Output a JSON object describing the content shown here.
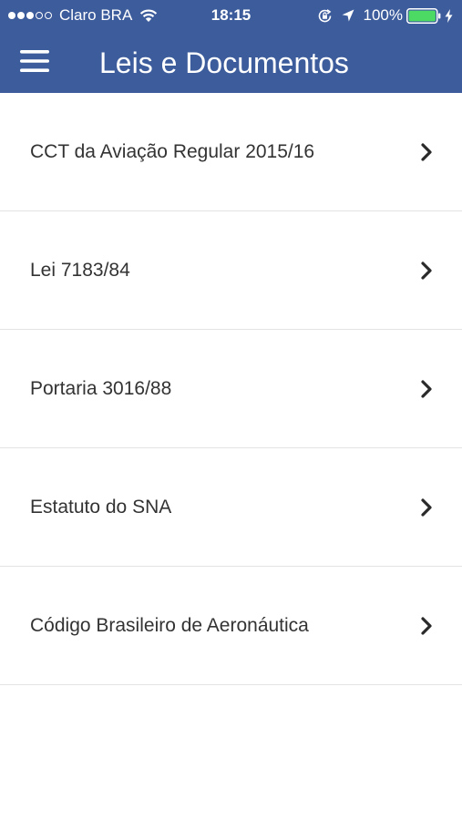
{
  "status_bar": {
    "carrier": "Claro BRA",
    "time": "18:15",
    "battery_percent": "100%",
    "signal_bars_full": 3,
    "signal_bars_total": 5,
    "battery_level": 1.0,
    "icons": [
      "wifi-icon",
      "orientation-lock-icon",
      "location-arrow-icon",
      "battery-icon",
      "charging-bolt-icon"
    ]
  },
  "header": {
    "title": "Leis e Documentos",
    "menu_icon": "hamburger-menu-icon",
    "background_color": "#3d5c9c",
    "text_color": "#ffffff"
  },
  "list": {
    "items": [
      {
        "label": "CCT da Aviação Regular 2015/16",
        "icon": "chevron-right-icon"
      },
      {
        "label": "Lei 7183/84",
        "icon": "chevron-right-icon"
      },
      {
        "label": "Portaria 3016/88",
        "icon": "chevron-right-icon"
      },
      {
        "label": "Estatuto do SNA",
        "icon": "chevron-right-icon"
      },
      {
        "label": "Código Brasileiro de Aeronáutica",
        "icon": "chevron-right-icon"
      }
    ]
  },
  "colors": {
    "battery_fill": "#4cd964",
    "divider": "#e3e3e3",
    "item_text": "#333333"
  }
}
